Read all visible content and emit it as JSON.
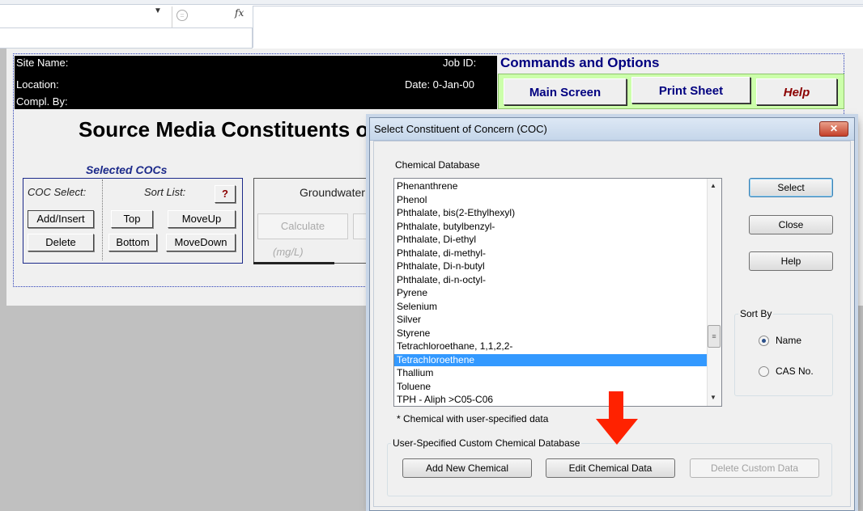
{
  "excel": {
    "name_box": "",
    "name_box_arrow": "▼",
    "cancel_glyph": "=",
    "fx": "fx",
    "formula": ""
  },
  "sheet": {
    "site_name_label": "Site Name:",
    "job_id_label": "Job ID:",
    "location_label": "Location:",
    "date_label": "Date:  0-Jan-00",
    "compl_by_label": "Compl. By:",
    "commands_title": "Commands and Options",
    "main_screen": "Main Screen",
    "print_sheet": "Print Sheet",
    "help": "Help",
    "page_title": "Source Media Constituents of Concern (COCs)",
    "selected_cocs": "Selected COCs",
    "coc_select_label": "COC Select:",
    "sort_list_label": "Sort List:",
    "question": "?",
    "add_insert": "Add/Insert",
    "delete": "Delete",
    "top": "Top",
    "bottom": "Bottom",
    "move_up": "MoveUp",
    "move_down": "MoveDown",
    "groundwater": "Groundwater",
    "calculate": "Calculate",
    "units": "(mg/L)"
  },
  "dialog": {
    "title": "Select Constituent of Concern (COC)",
    "close_glyph": "✕",
    "chemical_database_label": "Chemical Database",
    "chemicals": [
      "Phenanthrene",
      "Phenol",
      "Phthalate, bis(2-Ethylhexyl)",
      "Phthalate, butylbenzyl-",
      "Phthalate, Di-ethyl",
      "Phthalate, di-methyl-",
      "Phthalate, Di-n-butyl",
      "Phthalate, di-n-octyl-",
      "Pyrene",
      "Selenium",
      "Silver",
      "Styrene",
      "Tetrachloroethane, 1,1,2,2-",
      "Tetrachloroethene",
      "Thallium",
      "Toluene",
      "TPH - Aliph >C05-C06"
    ],
    "selected_chemical": "Tetrachloroethene",
    "user_note": "*  Chemical with user-specified data",
    "select_button": "Select",
    "close_button": "Close",
    "help_button": "Help",
    "sort_by_label": "Sort By",
    "sort_options": [
      "Name",
      "CAS No."
    ],
    "sort_selected": "Name",
    "custom_db_label": "User-Specified Custom Chemical Database",
    "add_new_chemical": "Add New Chemical",
    "edit_chemical_data": "Edit Chemical Data",
    "delete_custom_data": "Delete Custom Data",
    "scroll_up": "▲",
    "scroll_down": "▼",
    "scroll_grip": "≡"
  },
  "colors": {
    "arrow": "#ff2200",
    "selection": "#3399ff",
    "commands_panel": "#ccffaa",
    "title_blue": "#000080",
    "help_red": "#8b0000"
  }
}
